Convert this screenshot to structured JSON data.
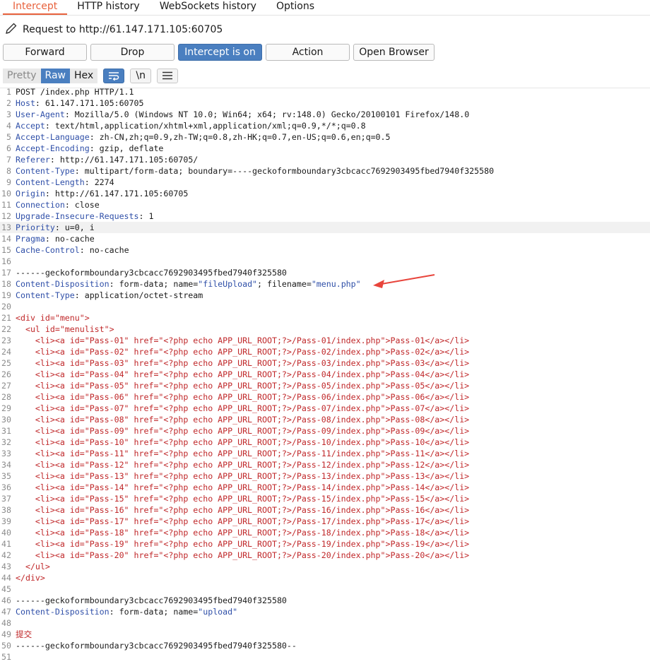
{
  "tabs": [
    "Intercept",
    "HTTP history",
    "WebSockets history",
    "Options"
  ],
  "request_label": "Request to http://61.147.171.105:60705",
  "toolbar": {
    "forward": "Forward",
    "drop": "Drop",
    "intercept": "Intercept is on",
    "action": "Action",
    "open_browser": "Open Browser"
  },
  "view": {
    "pretty": "Pretty",
    "raw": "Raw",
    "hex": "Hex",
    "newline_label": "\\n"
  },
  "lines": [
    {
      "n": "1",
      "t": "POST /index.php HTTP/1.1"
    },
    {
      "n": "2",
      "k": "Host",
      "v": ": 61.147.171.105:60705"
    },
    {
      "n": "3",
      "k": "User-Agent",
      "v": ": Mozilla/5.0 (Windows NT 10.0; Win64; x64; rv:148.0) Gecko/20100101 Firefox/148.0"
    },
    {
      "n": "4",
      "k": "Accept",
      "v": ": text/html,application/xhtml+xml,application/xml;q=0.9,*/*;q=0.8"
    },
    {
      "n": "5",
      "k": "Accept-Language",
      "v": ": zh-CN,zh;q=0.9,zh-TW;q=0.8,zh-HK;q=0.7,en-US;q=0.6,en;q=0.5"
    },
    {
      "n": "6",
      "k": "Accept-Encoding",
      "v": ": gzip, deflate"
    },
    {
      "n": "7",
      "k": "Referer",
      "v": ": http://61.147.171.105:60705/"
    },
    {
      "n": "8",
      "k": "Content-Type",
      "v": ": multipart/form-data; boundary=----geckoformboundary3cbcacc7692903495fbed7940f325580"
    },
    {
      "n": "9",
      "k": "Content-Length",
      "v": ": 2274"
    },
    {
      "n": "10",
      "k": "Origin",
      "v": ": http://61.147.171.105:60705"
    },
    {
      "n": "11",
      "k": "Connection",
      "v": ": close"
    },
    {
      "n": "12",
      "k": "Upgrade-Insecure-Requests",
      "v": ": 1"
    },
    {
      "n": "13",
      "k": "Priority",
      "v": ": u=0, i",
      "hl": true
    },
    {
      "n": "14",
      "k": "Pragma",
      "v": ": no-cache"
    },
    {
      "n": "15",
      "k": "Cache-Control",
      "v": ": no-cache"
    },
    {
      "n": "16",
      "t": ""
    },
    {
      "n": "17",
      "t": "------geckoformboundary3cbcacc7692903495fbed7940f325580"
    },
    {
      "n": "18",
      "k": "Content-Disposition",
      "parts": [
        ": form-data; name=",
        "\"fileUpload\"",
        "; filename=",
        "\"menu.php\""
      ]
    },
    {
      "n": "19",
      "k": "Content-Type",
      "v": ": application/octet-stream"
    },
    {
      "n": "20",
      "t": ""
    },
    {
      "n": "21",
      "r": "<div id=\"menu\">"
    },
    {
      "n": "22",
      "r": "  <ul id=\"menulist\">"
    },
    {
      "n": "23",
      "r": "    <li><a id=\"Pass-01\" href=\"<?php echo APP_URL_ROOT;?>/Pass-01/index.php\">Pass-01</a></li>"
    },
    {
      "n": "24",
      "r": "    <li><a id=\"Pass-02\" href=\"<?php echo APP_URL_ROOT;?>/Pass-02/index.php\">Pass-02</a></li>"
    },
    {
      "n": "25",
      "r": "    <li><a id=\"Pass-03\" href=\"<?php echo APP_URL_ROOT;?>/Pass-03/index.php\">Pass-03</a></li>"
    },
    {
      "n": "26",
      "r": "    <li><a id=\"Pass-04\" href=\"<?php echo APP_URL_ROOT;?>/Pass-04/index.php\">Pass-04</a></li>"
    },
    {
      "n": "27",
      "r": "    <li><a id=\"Pass-05\" href=\"<?php echo APP_URL_ROOT;?>/Pass-05/index.php\">Pass-05</a></li>"
    },
    {
      "n": "28",
      "r": "    <li><a id=\"Pass-06\" href=\"<?php echo APP_URL_ROOT;?>/Pass-06/index.php\">Pass-06</a></li>"
    },
    {
      "n": "29",
      "r": "    <li><a id=\"Pass-07\" href=\"<?php echo APP_URL_ROOT;?>/Pass-07/index.php\">Pass-07</a></li>"
    },
    {
      "n": "30",
      "r": "    <li><a id=\"Pass-08\" href=\"<?php echo APP_URL_ROOT;?>/Pass-08/index.php\">Pass-08</a></li>"
    },
    {
      "n": "31",
      "r": "    <li><a id=\"Pass-09\" href=\"<?php echo APP_URL_ROOT;?>/Pass-09/index.php\">Pass-09</a></li>"
    },
    {
      "n": "32",
      "r": "    <li><a id=\"Pass-10\" href=\"<?php echo APP_URL_ROOT;?>/Pass-10/index.php\">Pass-10</a></li>"
    },
    {
      "n": "33",
      "r": "    <li><a id=\"Pass-11\" href=\"<?php echo APP_URL_ROOT;?>/Pass-11/index.php\">Pass-11</a></li>"
    },
    {
      "n": "34",
      "r": "    <li><a id=\"Pass-12\" href=\"<?php echo APP_URL_ROOT;?>/Pass-12/index.php\">Pass-12</a></li>"
    },
    {
      "n": "35",
      "r": "    <li><a id=\"Pass-13\" href=\"<?php echo APP_URL_ROOT;?>/Pass-13/index.php\">Pass-13</a></li>"
    },
    {
      "n": "36",
      "r": "    <li><a id=\"Pass-14\" href=\"<?php echo APP_URL_ROOT;?>/Pass-14/index.php\">Pass-14</a></li>"
    },
    {
      "n": "37",
      "r": "    <li><a id=\"Pass-15\" href=\"<?php echo APP_URL_ROOT;?>/Pass-15/index.php\">Pass-15</a></li>"
    },
    {
      "n": "38",
      "r": "    <li><a id=\"Pass-16\" href=\"<?php echo APP_URL_ROOT;?>/Pass-16/index.php\">Pass-16</a></li>"
    },
    {
      "n": "39",
      "r": "    <li><a id=\"Pass-17\" href=\"<?php echo APP_URL_ROOT;?>/Pass-17/index.php\">Pass-17</a></li>"
    },
    {
      "n": "40",
      "r": "    <li><a id=\"Pass-18\" href=\"<?php echo APP_URL_ROOT;?>/Pass-18/index.php\">Pass-18</a></li>"
    },
    {
      "n": "41",
      "r": "    <li><a id=\"Pass-19\" href=\"<?php echo APP_URL_ROOT;?>/Pass-19/index.php\">Pass-19</a></li>"
    },
    {
      "n": "42",
      "r": "    <li><a id=\"Pass-20\" href=\"<?php echo APP_URL_ROOT;?>/Pass-20/index.php\">Pass-20</a></li>"
    },
    {
      "n": "43",
      "r": "  </ul>"
    },
    {
      "n": "44",
      "r": "</div>"
    },
    {
      "n": "45",
      "t": ""
    },
    {
      "n": "46",
      "t": "------geckoformboundary3cbcacc7692903495fbed7940f325580"
    },
    {
      "n": "47",
      "k": "Content-Disposition",
      "parts": [
        ": form-data; name=",
        "\"upload\""
      ]
    },
    {
      "n": "48",
      "t": ""
    },
    {
      "n": "49",
      "r": "提交"
    },
    {
      "n": "50",
      "t": "------geckoformboundary3cbcacc7692903495fbed7940f325580--"
    },
    {
      "n": "51",
      "t": ""
    }
  ],
  "colors": {
    "accent": "#e8623d",
    "button_on": "#4a7fc0",
    "header_key": "#2f4fa8",
    "body_red": "#c0282a",
    "annotation_arrow": "#e8453c"
  },
  "icons": [
    "pencil-icon",
    "word-wrap-icon",
    "hamburger-menu-icon",
    "annotation-arrow"
  ]
}
